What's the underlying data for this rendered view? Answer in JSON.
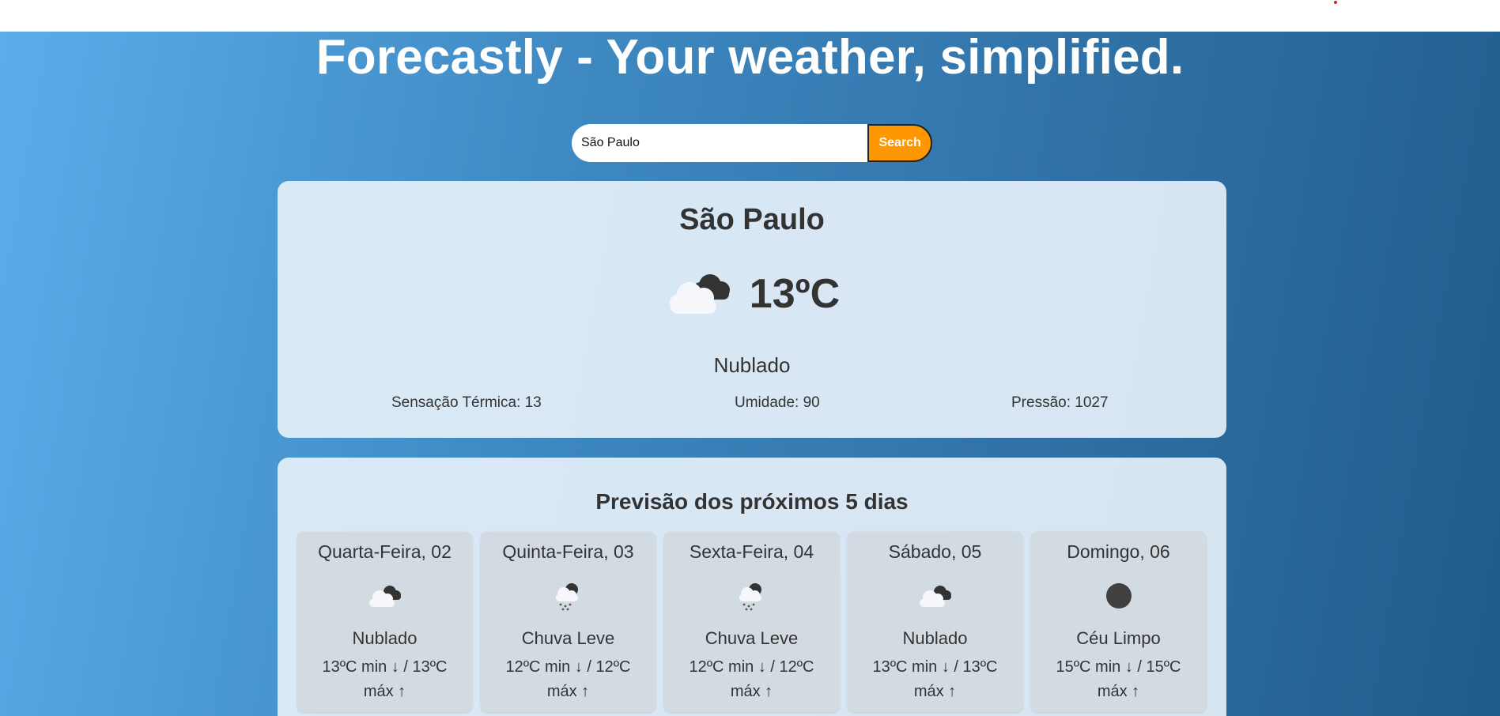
{
  "header": {
    "title": "Forecastly - Your weather, simplified."
  },
  "search": {
    "value": "São Paulo",
    "button_label": "Search"
  },
  "current": {
    "city": "São Paulo",
    "icon": "cloudy-icon",
    "temperature": "13ºC",
    "description": "Nublado",
    "feels_like": "Sensação Térmica: 13",
    "humidity": "Umidade: 90",
    "pressure": "Pressão: 1027"
  },
  "forecast": {
    "title": "Previsão dos próximos 5 dias",
    "days": [
      {
        "day": "Quarta-Feira, 02",
        "icon": "cloudy-icon",
        "description": "Nublado",
        "temp": "13ºC min ↓ / 13ºC máx ↑"
      },
      {
        "day": "Quinta-Feira, 03",
        "icon": "light-rain-icon",
        "description": "Chuva Leve",
        "temp": "12ºC min ↓ / 12ºC máx ↑"
      },
      {
        "day": "Sexta-Feira, 04",
        "icon": "light-rain-icon",
        "description": "Chuva Leve",
        "temp": "12ºC min ↓ / 12ºC máx ↑"
      },
      {
        "day": "Sábado, 05",
        "icon": "cloudy-icon",
        "description": "Nublado",
        "temp": "13ºC min ↓ / 13ºC máx ↑"
      },
      {
        "day": "Domingo, 06",
        "icon": "clear-sky-icon",
        "description": "Céu Limpo",
        "temp": "15ºC min ↓ / 15ºC máx ↑"
      }
    ]
  },
  "colors": {
    "accent": "#ff9800",
    "gradient_start": "#5badea",
    "gradient_end": "#215b8a",
    "text": "#333333"
  }
}
